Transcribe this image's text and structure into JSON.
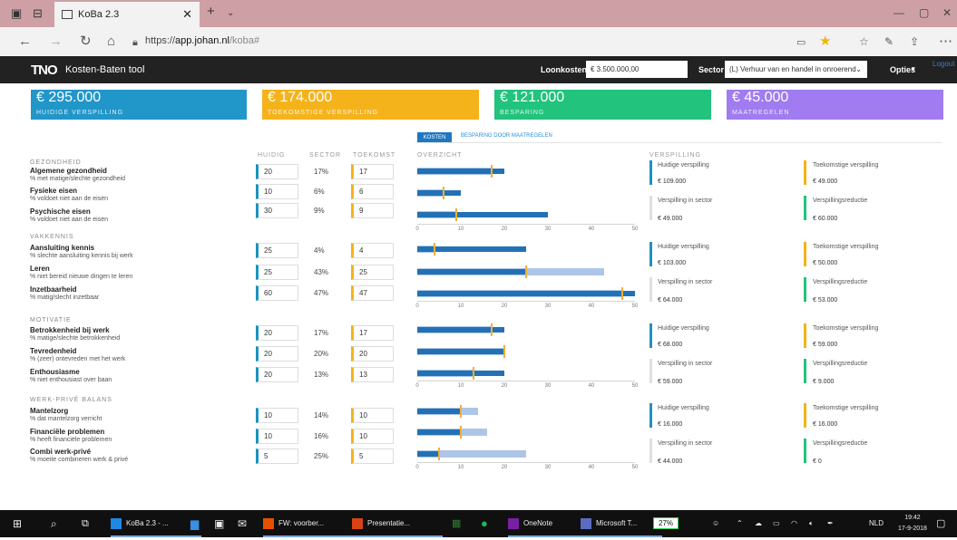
{
  "browser": {
    "tab_title": "KoBa 2.3",
    "url_domain": "app.johan.nl",
    "url_rest": "/koba#",
    "url_scheme": "https://"
  },
  "app": {
    "logo": "TNO",
    "title": "Kosten-Baten tool",
    "loonkosten_label": "Loonkosten",
    "loonkosten_value": "€ 3.500.000,00",
    "sector_label": "Sector",
    "sector_value": "(L) Verhuur van en handel in onroerend",
    "opties": "Opties",
    "logout": "Logout"
  },
  "kpis": [
    {
      "value": "€ 295.000",
      "label": "HUIDIGE VERSPILLING",
      "color": "#2196c9"
    },
    {
      "value": "€ 174.000",
      "label": "TOEKOMSTIGE VERSPILLING",
      "color": "#f5b31b"
    },
    {
      "value": "€ 121.000",
      "label": "BESPARING",
      "color": "#21c37d"
    },
    {
      "value": "€ 45.000",
      "label": "MAATREGELEN",
      "color": "#a07cf0"
    }
  ],
  "tabs": {
    "kosten": "KOSTEN",
    "besparing": "BESPARING DOOR MAATREGELEN"
  },
  "columns": {
    "huidig": "HUIDIG",
    "sector": "SECTOR",
    "toekomst": "TOEKOMST",
    "overzicht": "OVERZICHT",
    "verspilling": "VERSPILLING"
  },
  "axis_ticks": [
    "0",
    "10",
    "20",
    "30",
    "40",
    "50"
  ],
  "chart_data": {
    "type": "bar",
    "xlim": [
      0,
      50
    ],
    "series": [
      "huidig",
      "sector",
      "toekomst"
    ]
  },
  "sections": [
    {
      "title": "GEZONDHEID",
      "rows": [
        {
          "name": "Algemene gezondheid",
          "sub": "% met matige/slechte gezondheid",
          "huidig": "20",
          "sector": "17%",
          "toekomst": "17",
          "h": 20,
          "s": 17,
          "t": 17
        },
        {
          "name": "Fysieke eisen",
          "sub": "% voldoet niet aan de eisen",
          "huidig": "10",
          "sector": "6%",
          "toekomst": "6",
          "h": 10,
          "s": 6,
          "t": 6
        },
        {
          "name": "Psychische eisen",
          "sub": "% voldoet niet aan de eisen",
          "huidig": "30",
          "sector": "9%",
          "toekomst": "9",
          "h": 30,
          "s": 9,
          "t": 9
        }
      ],
      "v": {
        "huidig_label": "Huidige verspilling",
        "huidig": "€ 109.000",
        "sector_label": "Verspilling in sector",
        "sector": "€ 49.000",
        "toek_label": "Toekomstige verspilling",
        "toek": "€ 49.000",
        "red_label": "Verspillingsreductie",
        "red": "€ 60.000"
      }
    },
    {
      "title": "VAKKENNIS",
      "rows": [
        {
          "name": "Aansluiting kennis",
          "sub": "% slechte aansluiting kennis bij werk",
          "huidig": "25",
          "sector": "4%",
          "toekomst": "4",
          "h": 25,
          "s": 4,
          "t": 4
        },
        {
          "name": "Leren",
          "sub": "% niet bereid nieuwe dingen te leren",
          "huidig": "25",
          "sector": "43%",
          "toekomst": "25",
          "h": 25,
          "s": 43,
          "t": 25
        },
        {
          "name": "Inzetbaarheid",
          "sub": "% matig/slecht inzetbaar",
          "huidig": "60",
          "sector": "47%",
          "toekomst": "47",
          "h": 60,
          "s": 47,
          "t": 47
        }
      ],
      "v": {
        "huidig_label": "Huidige verspilling",
        "huidig": "€ 103.000",
        "sector_label": "Verspilling in sector",
        "sector": "€ 64.000",
        "toek_label": "Toekomstige verspilling",
        "toek": "€ 50.000",
        "red_label": "Verspillingsreductie",
        "red": "€ 53.000"
      }
    },
    {
      "title": "MOTIVATIE",
      "rows": [
        {
          "name": "Betrokkenheid bij werk",
          "sub": "% matige/slechte betrokkenheid",
          "huidig": "20",
          "sector": "17%",
          "toekomst": "17",
          "h": 20,
          "s": 17,
          "t": 17
        },
        {
          "name": "Tevredenheid",
          "sub": "% (zeer) ontevreden met het werk",
          "huidig": "20",
          "sector": "20%",
          "toekomst": "20",
          "h": 20,
          "s": 20,
          "t": 20
        },
        {
          "name": "Enthousiasme",
          "sub": "% niet enthousiast over baan",
          "huidig": "20",
          "sector": "13%",
          "toekomst": "13",
          "h": 20,
          "s": 13,
          "t": 13
        }
      ],
      "v": {
        "huidig_label": "Huidige verspilling",
        "huidig": "€ 68.000",
        "sector_label": "Verspilling in sector",
        "sector": "€ 59.000",
        "toek_label": "Toekomstige verspilling",
        "toek": "€ 59.000",
        "red_label": "Verspillingsreductie",
        "red": "€ 9.000"
      }
    },
    {
      "title": "WERK-PRIVÉ BALANS",
      "rows": [
        {
          "name": "Mantelzorg",
          "sub": "% dat mantelzorg verricht",
          "huidig": "10",
          "sector": "14%",
          "toekomst": "10",
          "h": 10,
          "s": 14,
          "t": 10
        },
        {
          "name": "Financiële problemen",
          "sub": "% heeft financiële problemen",
          "huidig": "10",
          "sector": "16%",
          "toekomst": "10",
          "h": 10,
          "s": 16,
          "t": 10
        },
        {
          "name": "Combi werk-privé",
          "sub": "% moeite combineren werk & privé",
          "huidig": "5",
          "sector": "25%",
          "toekomst": "5",
          "h": 5,
          "s": 25,
          "t": 5
        }
      ],
      "v": {
        "huidig_label": "Huidige verspilling",
        "huidig": "€ 16.000",
        "sector_label": "Verspilling in sector",
        "sector": "€ 44.000",
        "toek_label": "Toekomstige verspilling",
        "toek": "€ 16.000",
        "red_label": "Verspillingsreductie",
        "red": "€ 0"
      }
    }
  ],
  "taskbar": {
    "items": [
      {
        "label": "KoBa 2.3 - ...",
        "color": "#1e88e5"
      },
      {
        "label": "FW: voorber...",
        "color": "#e65100"
      },
      {
        "label": "Presentatie...",
        "color": "#d84315"
      },
      {
        "label": "OneNote",
        "color": "#7b1fa2"
      },
      {
        "label": "Microsoft T...",
        "color": "#5c6bc0"
      }
    ],
    "battery": "27%",
    "lang": "NLD",
    "time": "19:42",
    "date": "17-9-2018"
  }
}
